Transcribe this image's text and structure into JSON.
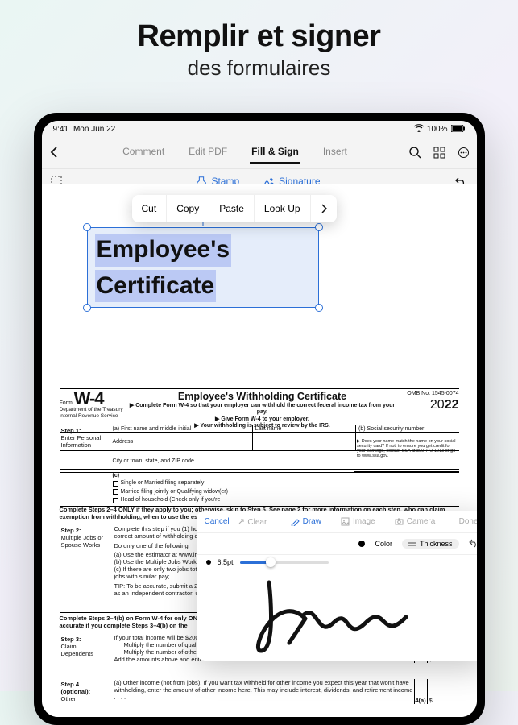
{
  "promo": {
    "headline": "Remplir et signer",
    "subhead": "des formulaires"
  },
  "statusbar": {
    "time": "9:41",
    "date": "Mon Jun 22",
    "battery": "100%"
  },
  "tabs": {
    "comment": "Comment",
    "edit": "Edit PDF",
    "fill": "Fill & Sign",
    "insert": "Insert"
  },
  "tools": {
    "stamp": "Stamp",
    "signature": "Signature"
  },
  "context": {
    "cut": "Cut",
    "copy": "Copy",
    "paste": "Paste",
    "lookup": "Look Up"
  },
  "selection": {
    "line1": "Employee's",
    "line2": "Certificate"
  },
  "form": {
    "form_word": "Form",
    "w4": "W-4",
    "dept": "Department of the Treasury",
    "irs": "Internal Revenue Service",
    "title": "Employee's Withholding Certificate",
    "bullet1": "▶ Complete Form W-4 so that your employer can withhold the correct federal income tax from your pay.",
    "bullet2": "▶ Give Form W-4 to your employer.",
    "bullet3": "▶ Your withholding is subject to review by the IRS.",
    "omb": "OMB No. 1545-0074",
    "year_20": "20",
    "year_22": "22",
    "step1_h": "Step 1:",
    "step1_t": "Enter Personal Information",
    "cell_a": "(a)   First name and middle initial",
    "cell_last": "Last name",
    "cell_b": "(b)   Social security number",
    "cell_addr": "Address",
    "cell_city": "City or town, state, and ZIP code",
    "cell_ssn_note": "▶ Does your name match the name on your social security card? If not, to ensure you get credit for your earnings, contact SSA at 800-772-1213 or go to www.ssa.gov.",
    "c_single": "Single or Married filing separately",
    "c_married": "Married filing jointly or Qualifying widow(er)",
    "c_hoh": "Head of household (Check only if you're",
    "c_label": "(c)",
    "step24_intro": "Complete Steps 2–4 ONLY if they apply to you; otherwise, skip to Step 5. See page 2 for more information on each step, who can claim exemption from withholding, when to use the estimator at",
    "step2_h": "Step 2:",
    "step2_t": "Multiple Jobs or Spouse Works",
    "step2_body1": "Complete this step if you (1) hold more than one job at a time, or (2) are married filing jointly and your spouse also works. The correct amount of withholding depends on income earned from all of these jobs.",
    "step2_body2": "Do only one of the following.",
    "step2_a": "(a) Use the estimator at www.irs.gov/W4App for most accurate withholding for this step (and Steps 3–4); or",
    "step2_b": "(b) Use the Multiple Jobs Worksheet on page 3 and enter the result in Step 4(c) below for roughly accurate withholding; or",
    "step2_c": "(c) If there are only two jobs total, you may check this box. Do the same on Form W-4 for the other job. This option is accurate for jobs with similar pay;",
    "step2_tip": "TIP: To be accurate, submit a 2022 Form W-4 for all other jobs. If you (or your spouse) have self-employment income, including as an independent contractor, use the estimator.",
    "step34_intro": "Complete Steps 3–4(b) on Form W-4 for only ONE of these jobs. Leave those steps blank for the other jobs. (Your withholding will be most accurate if you complete Steps 3–4(b) on the",
    "step3_h": "Step 3:",
    "step3_t": "Claim Dependents",
    "step3_l1": "If your total income will be $200,000 or less ($400,000 or less if married filing jointly):",
    "step3_l2": "Multiply the number of qualifying children under age 17 by $2,000   ▶  $",
    "step3_l3": "Multiply the number of other dependents by $500   . . . . . . .  ▶  $",
    "step3_l4": "Add the amounts above and enter the total here  . . . . . . . . . . . . . . . . . . . . . . .",
    "step3_num": "3",
    "step3_amt": "$",
    "step4_h": "Step 4 (optional):",
    "step4_t": "Other",
    "step4_a": "(a) Other income (not from jobs). If you want tax withheld for other income you expect this year that won't have withholding, enter the amount of other income here. This may include interest, dividends, and retirement income  . . . .",
    "step4_num": "4(a)",
    "step4_amt": "$"
  },
  "sig": {
    "cancel": "Cancel",
    "clear": "Clear",
    "draw": "Draw",
    "image": "Image",
    "camera": "Camera",
    "done": "Done",
    "color": "Color",
    "thickness": "Thickness",
    "pt": "6.5pt"
  }
}
